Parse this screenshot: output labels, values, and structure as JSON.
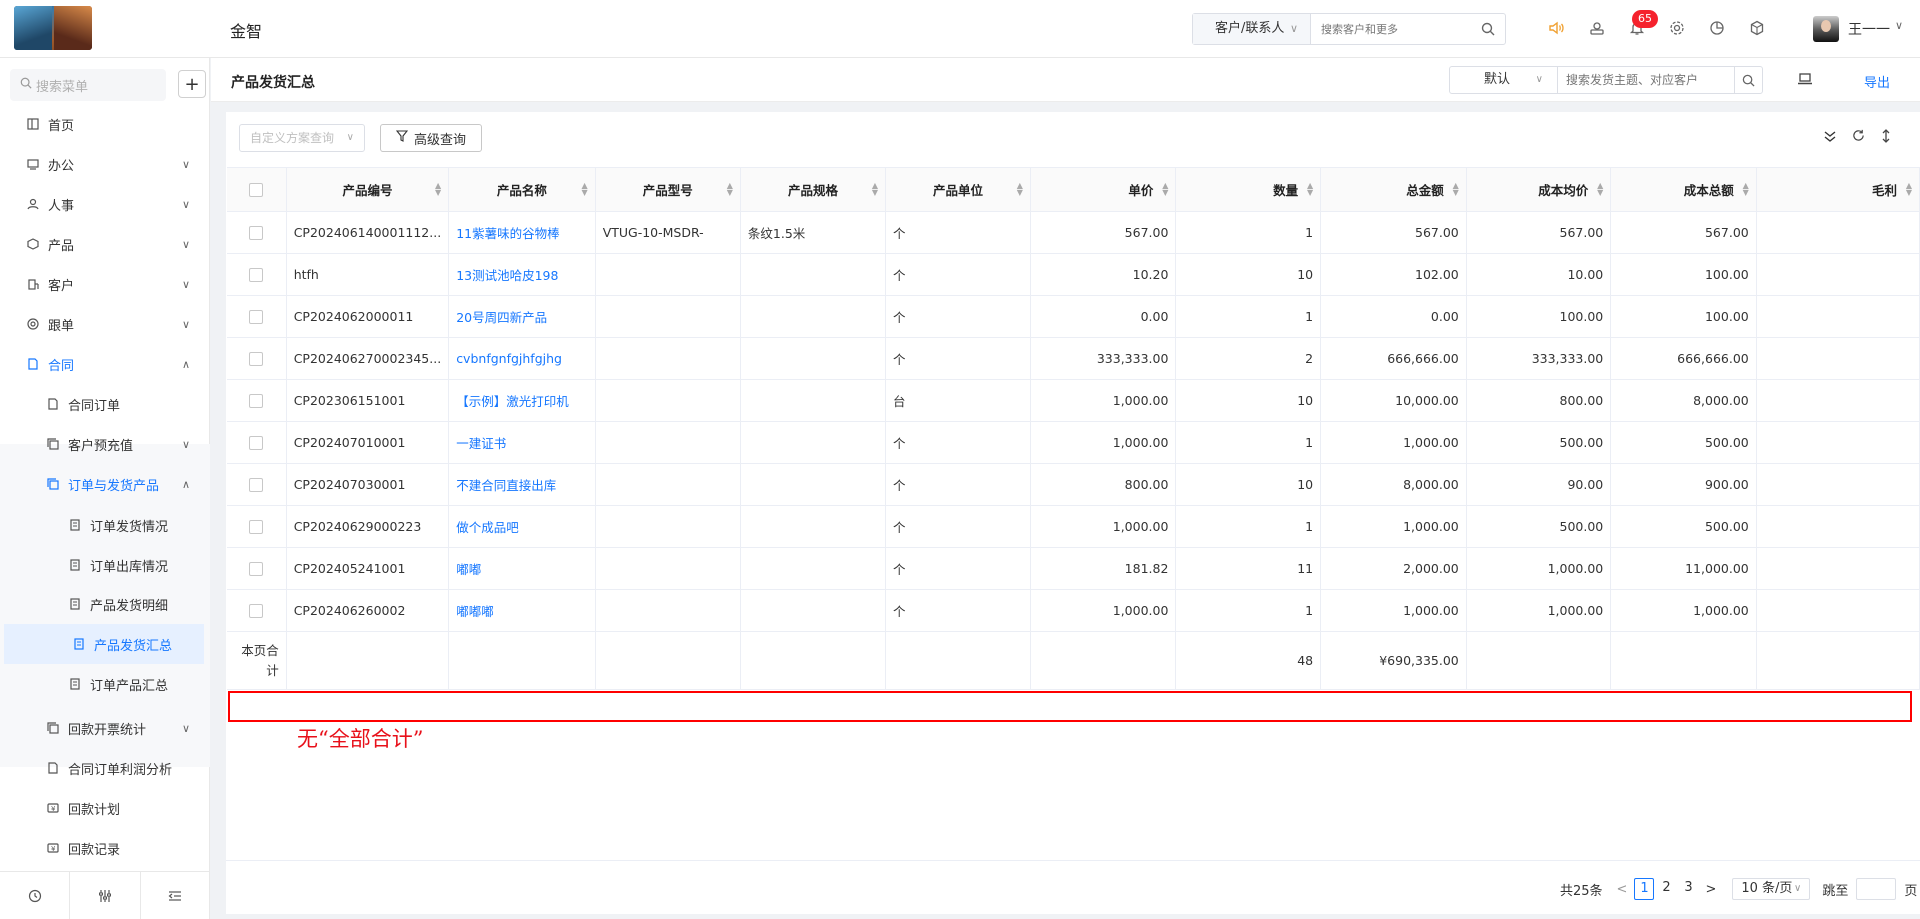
{
  "header": {
    "app_name": "金智",
    "search_scope": "客户/联系人",
    "search_placeholder": "搜索客户和更多",
    "notification_count": "65",
    "user_name": "王一一"
  },
  "sidebar": {
    "search_placeholder": "搜索菜单",
    "add_label": "+",
    "items": [
      {
        "label": "首页",
        "icon": "home-icon"
      },
      {
        "label": "办公",
        "icon": "office-icon"
      },
      {
        "label": "人事",
        "icon": "people-icon"
      },
      {
        "label": "产品",
        "icon": "box-icon"
      },
      {
        "label": "客户",
        "icon": "building-icon"
      },
      {
        "label": "跟单",
        "icon": "follow-icon"
      },
      {
        "label": "合同",
        "icon": "contract-icon"
      }
    ],
    "sub_items": [
      {
        "label": "合同订单"
      },
      {
        "label": "客户预充值"
      },
      {
        "label": "订单与发货产品"
      }
    ],
    "sub_sub_items": [
      {
        "label": "订单发货情况"
      },
      {
        "label": "订单出库情况"
      },
      {
        "label": "产品发货明细"
      },
      {
        "label": "产品发货汇总"
      },
      {
        "label": "订单产品汇总"
      }
    ],
    "more_items": [
      {
        "label": "回款开票统计"
      },
      {
        "label": "合同订单利润分析"
      },
      {
        "label": "回款计划"
      },
      {
        "label": "回款记录"
      }
    ]
  },
  "page": {
    "title": "产品发货汇总",
    "view_select": "默认",
    "search_placeholder": "搜索发货主题、对应客户",
    "export_label": "导出"
  },
  "filters": {
    "scheme_placeholder": "自定义方案查询",
    "advanced_label": "高级查询"
  },
  "table": {
    "columns": [
      "产品编号",
      "产品名称",
      "产品型号",
      "产品规格",
      "产品单位",
      "单价",
      "数量",
      "总金额",
      "成本均价",
      "成本总额",
      "毛利"
    ],
    "rows": [
      [
        "CP202406140001112...",
        "11紫薯味的谷物棒",
        "VTUG-10-MSDR-",
        "条纹1.5米",
        "个",
        "567.00",
        "1",
        "567.00",
        "567.00",
        "567.00",
        ""
      ],
      [
        "htfh",
        "13测试池哈皮198",
        "",
        "",
        "个",
        "10.20",
        "10",
        "102.00",
        "10.00",
        "100.00",
        ""
      ],
      [
        "CP2024062000011",
        "20号周四新产品",
        "",
        "",
        "个",
        "0.00",
        "1",
        "0.00",
        "100.00",
        "100.00",
        ""
      ],
      [
        "CP202406270002345...",
        "cvbnfgnfgjhfgjhg",
        "",
        "",
        "个",
        "333,333.00",
        "2",
        "666,666.00",
        "333,333.00",
        "666,666.00",
        ""
      ],
      [
        "CP202306151001",
        "【示例】激光打印机",
        "",
        "",
        "台",
        "1,000.00",
        "10",
        "10,000.00",
        "800.00",
        "8,000.00",
        ""
      ],
      [
        "CP202407010001",
        "一建证书",
        "",
        "",
        "个",
        "1,000.00",
        "1",
        "1,000.00",
        "500.00",
        "500.00",
        ""
      ],
      [
        "CP202407030001",
        "不建合同直接出库",
        "",
        "",
        "个",
        "800.00",
        "10",
        "8,000.00",
        "90.00",
        "900.00",
        ""
      ],
      [
        "CP20240629000223",
        "做个成品吧",
        "",
        "",
        "个",
        "1,000.00",
        "1",
        "1,000.00",
        "500.00",
        "500.00",
        ""
      ],
      [
        "CP202405241001",
        "嘟嘟",
        "",
        "",
        "个",
        "181.82",
        "11",
        "2,000.00",
        "1,000.00",
        "11,000.00",
        ""
      ],
      [
        "CP202406260002",
        "嘟嘟嘟",
        "",
        "",
        "个",
        "1,000.00",
        "1",
        "1,000.00",
        "1,000.00",
        "1,000.00",
        ""
      ]
    ],
    "total_label": "本页合计",
    "total_quantity": "48",
    "total_amount": "¥690,335.00"
  },
  "annotation": {
    "note": "无“全部合计”",
    "color": "#e8101a"
  },
  "pagination": {
    "total_text": "共25条",
    "pages": [
      "1",
      "2",
      "3"
    ],
    "current_page": "1",
    "page_size": "10 条/页",
    "jump_label": "跳至",
    "page_suffix": "页"
  }
}
